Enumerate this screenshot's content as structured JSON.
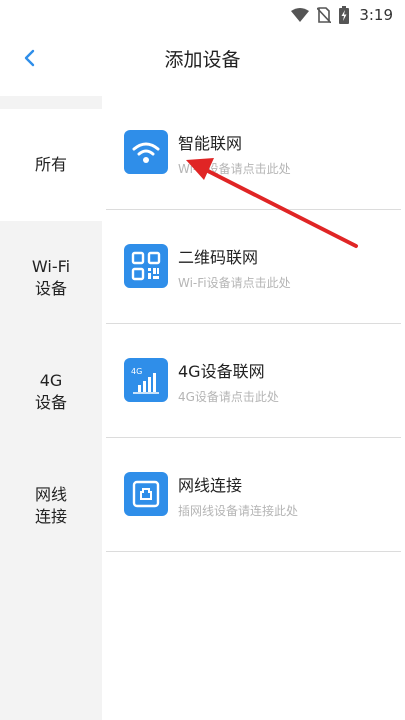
{
  "status_bar": {
    "time": "3:19",
    "icons": [
      "wifi-icon",
      "no-sim-icon",
      "battery-charging-icon"
    ]
  },
  "header": {
    "back_icon": "chevron-left-icon",
    "title": "添加设备"
  },
  "sidebar": {
    "items": [
      {
        "label": "所有",
        "active": true
      },
      {
        "label": "Wi-Fi\n设备",
        "active": false
      },
      {
        "label": "4G\n设备",
        "active": false
      },
      {
        "label": "网线\n连接",
        "active": false
      }
    ]
  },
  "options": [
    {
      "icon": "wifi-icon",
      "title": "智能联网",
      "subtitle": "Wi-Fi设备请点击此处"
    },
    {
      "icon": "qr-code-icon",
      "title": "二维码联网",
      "subtitle": "Wi-Fi设备请点击此处"
    },
    {
      "icon": "4g-signal-icon",
      "title": "4G设备联网",
      "subtitle": "4G设备请点击此处",
      "icon_text": "4G"
    },
    {
      "icon": "ethernet-port-icon",
      "title": "网线连接",
      "subtitle": "插网线设备请连接此处"
    }
  ],
  "colors": {
    "accent": "#2f8ee9",
    "sidebar_bg": "#f3f3f3",
    "annotation_arrow": "#e02525"
  }
}
